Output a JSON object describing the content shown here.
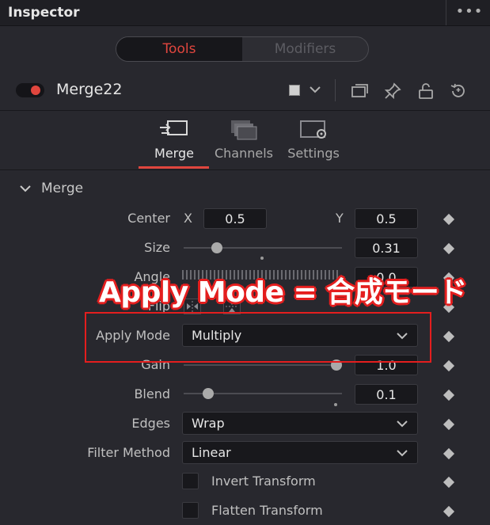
{
  "window": {
    "title": "Inspector",
    "menu_glyph": "•••"
  },
  "segment": {
    "tools_label": "Tools",
    "modifiers_label": "Modifiers",
    "active": "Tools"
  },
  "node": {
    "name": "Merge22",
    "enabled": true
  },
  "tabs": [
    {
      "label": "Merge",
      "icon": "merge-icon",
      "active": true
    },
    {
      "label": "Channels",
      "icon": "channels-icon",
      "active": false
    },
    {
      "label": "Settings",
      "icon": "settings-icon",
      "active": false
    }
  ],
  "section": {
    "title": "Merge",
    "expanded": true
  },
  "controls": {
    "center": {
      "label": "Center",
      "x_label": "X",
      "x_value": "0.5",
      "y_label": "Y",
      "y_value": "0.5"
    },
    "size": {
      "label": "Size",
      "value": "0.31",
      "slider_fraction": 0.19
    },
    "angle": {
      "label": "Angle",
      "value": "0.0"
    },
    "flip": {
      "label": "Flip"
    },
    "apply_mode": {
      "label": "Apply Mode",
      "value": "Multiply"
    },
    "gain": {
      "label": "Gain",
      "value": "1.0",
      "slider_fraction": 1.0
    },
    "blend": {
      "label": "Blend",
      "value": "0.1",
      "slider_fraction": 0.13
    },
    "edges": {
      "label": "Edges",
      "value": "Wrap"
    },
    "filter_method": {
      "label": "Filter Method",
      "value": "Linear"
    },
    "invert_transform": {
      "label": "Invert Transform",
      "checked": false
    },
    "flatten_transform": {
      "label": "Flatten Transform",
      "checked": false
    }
  },
  "annotation": {
    "text": "Apply Mode = 合成モード",
    "color": "#e41e1e"
  },
  "colors": {
    "accent": "#e0463e",
    "background": "#28282e",
    "field": "#18181c"
  }
}
